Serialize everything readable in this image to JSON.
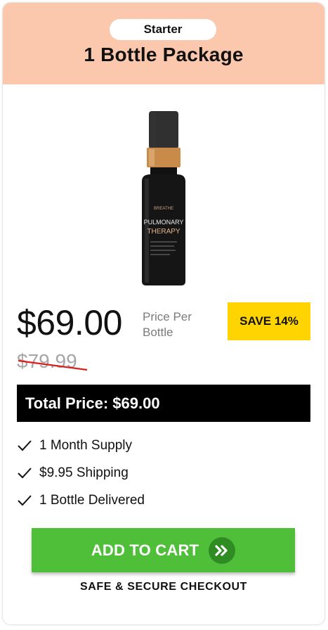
{
  "header": {
    "badge": "Starter",
    "title": "1 Bottle Package"
  },
  "product": {
    "brand": "BREATHE",
    "name_line1": "PULMONARY",
    "name_line2": "THERAPY",
    "image_icon": "bottle-image"
  },
  "pricing": {
    "price": "$69.00",
    "per_label": "Price Per Bottle",
    "save_badge": "SAVE 14%",
    "old_price": "$79.99",
    "total": "Total Price: $69.00"
  },
  "features": [
    {
      "text": "1 Month Supply",
      "icon": "check-icon"
    },
    {
      "text": "$9.95 Shipping",
      "icon": "check-icon"
    },
    {
      "text": "1 Bottle Delivered",
      "icon": "check-icon"
    }
  ],
  "cta": {
    "label": "ADD TO CART",
    "icon": "double-chevron-right-icon"
  },
  "footer": {
    "secure_text": "SAFE & SECURE CHECKOUT"
  },
  "colors": {
    "header_bg": "#fbc8ad",
    "save_bg": "#ffd400",
    "cta_bg": "#4fbf3a",
    "cta_icon_bg": "#2f8c22",
    "strike": "#d9211e",
    "cap_gold": "#c98a4a"
  }
}
